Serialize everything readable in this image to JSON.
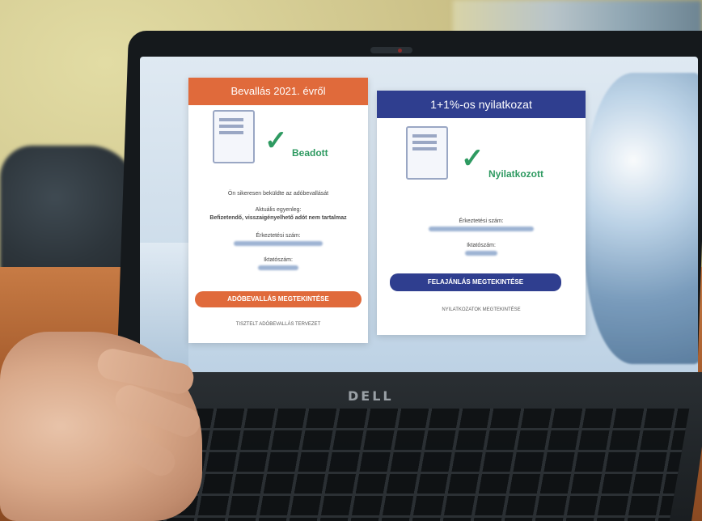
{
  "device": {
    "brand_logo": "DELL"
  },
  "screen": {
    "card_left": {
      "header": "Bevallás 2021. évről",
      "status": "Beadott",
      "message": "Ön sikeresen beküldte az adóbevallását",
      "balance_label": "Aktuális egyenleg:",
      "balance_text": "Befizetendő, visszaigényelhető adót nem tartalmaz",
      "reg_number_label": "Érkeztetési szám:",
      "filing_number_label": "Iktatószám:",
      "button_label": "ADÓBEVALLÁS MEGTEKINTÉSE",
      "link_label": "TISZTELT ADÓBEVALLÁS TERVEZET"
    },
    "card_right": {
      "header": "1+1%-os nyilatkozat",
      "status": "Nyilatkozott",
      "reg_number_label": "Érkeztetési szám:",
      "filing_number_label": "Iktatószám:",
      "button_label": "FELAJÁNLÁS MEGTEKINTÉSE",
      "link_label": "NYILATKOZATOK MEGTEKINTÉSE"
    },
    "icons": {
      "left_doc": "tax-document-icon",
      "left_check": "checkmark-icon",
      "right_doc": "percent-document-icon",
      "right_check": "checkmark-icon"
    },
    "colors": {
      "orange": "#e06a3b",
      "navy": "#2f3e8f",
      "green": "#2e9a61"
    }
  }
}
